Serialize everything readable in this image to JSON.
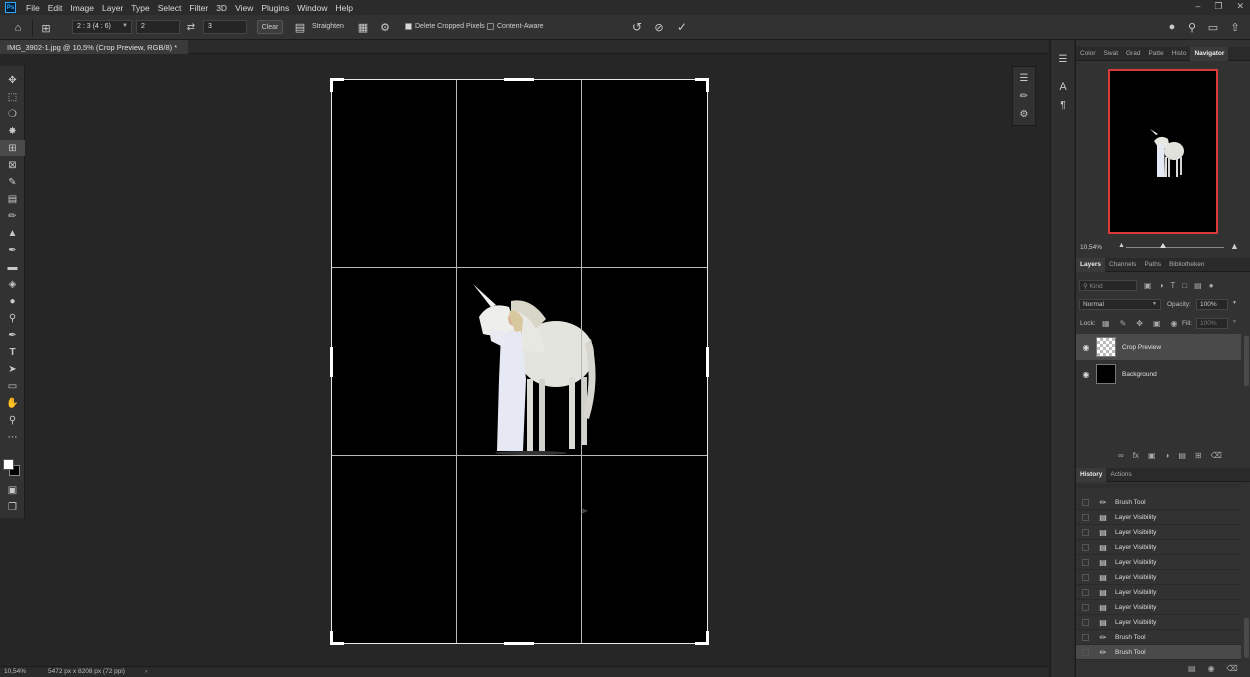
{
  "menu": [
    "File",
    "Edit",
    "Image",
    "Layer",
    "Type",
    "Select",
    "Filter",
    "3D",
    "View",
    "Plugins",
    "Window",
    "Help"
  ],
  "options": {
    "ratio_preset": "2 : 3 (4 : 6)",
    "width_value": "2",
    "height_value": "3",
    "clear_label": "Clear",
    "straighten_label": "Straighten",
    "delete_cropped_label": "Delete Cropped Pixels",
    "content_aware_label": "Content-Aware"
  },
  "document": {
    "tab_title": "IMG_3902-1.jpg @ 10,5% (Crop Preview, RGB/8) *"
  },
  "status": {
    "zoom": "10,54%",
    "dimensions": "5472 px x 8208 px (72 ppi)"
  },
  "top_panel": {
    "tabs": [
      "Color",
      "Swat",
      "Grad",
      "Patte",
      "Histo",
      "Navigator"
    ],
    "active_tab": "Navigator",
    "zoom": "10,54%"
  },
  "layers_panel": {
    "tabs": [
      "Layers",
      "Channels",
      "Paths",
      "Bibliotheken"
    ],
    "kind_placeholder": "Kind",
    "blend_mode": "Normal",
    "opacity_label": "Opacity:",
    "opacity_value": "100%",
    "lock_label": "Lock:",
    "fill_label": "Fill:",
    "fill_value": "100%",
    "layers": [
      {
        "name": "Crop Preview"
      },
      {
        "name": "Background"
      }
    ]
  },
  "history_panel": {
    "tabs": [
      "History",
      "Actions"
    ],
    "items": [
      "Brush Tool",
      "Layer Visibility",
      "Layer Visibility",
      "Layer Visibility",
      "Layer Visibility",
      "Layer Visibility",
      "Layer Visibility",
      "Layer Visibility",
      "Layer Visibility",
      "Brush Tool",
      "Brush Tool"
    ]
  },
  "colors": {
    "accent_red": "#d93a3a",
    "panel_bg": "#323232",
    "canvas_bg": "#262626"
  }
}
